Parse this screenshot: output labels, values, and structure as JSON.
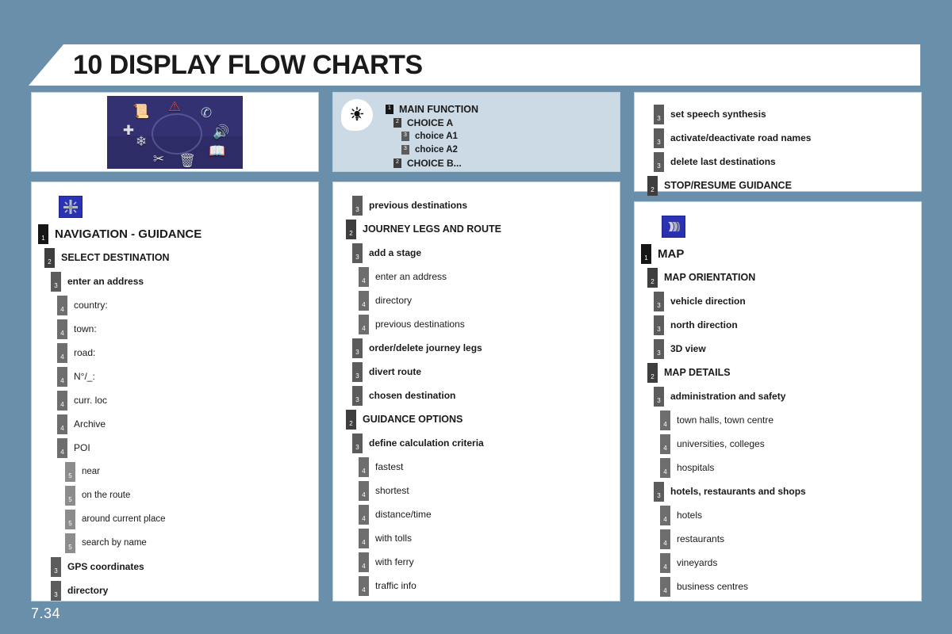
{
  "page": {
    "background_color": "#6a8fab",
    "title": "10 DISPLAY FLOW CHARTS",
    "page_number": "7.34"
  },
  "screenshot_panel": {
    "icon_names": [
      "documents-icon",
      "warning-triangle-icon",
      "telephone-icon",
      "radio-icon",
      "books-icon",
      "trash-icon",
      "tools-icon",
      "air-conditioning-icon",
      "navigation-icon"
    ]
  },
  "legend": {
    "bulb_icon": "lightbulb-icon",
    "rows": [
      {
        "level": 1,
        "indent": 0,
        "label": "MAIN FUNCTION"
      },
      {
        "level": 2,
        "indent": 1,
        "label": "CHOICE A"
      },
      {
        "level": 3,
        "indent": 2,
        "label": "choice A1"
      },
      {
        "level": 3,
        "indent": 2,
        "label": "choice A2"
      },
      {
        "level": 2,
        "indent": 1,
        "label": "CHOICE B..."
      }
    ]
  },
  "columns": [
    {
      "name": "navigation-guidance-column",
      "section_icon": "crossroads-icon",
      "rows": [
        {
          "level": 1,
          "indent": 0,
          "label": "NAVIGATION - GUIDANCE"
        },
        {
          "level": 2,
          "indent": 1,
          "label": "SELECT DESTINATION"
        },
        {
          "level": 3,
          "indent": 2,
          "label": "enter an address"
        },
        {
          "level": 4,
          "indent": 3,
          "label": "country:"
        },
        {
          "level": 4,
          "indent": 3,
          "label": "town:"
        },
        {
          "level": 4,
          "indent": 3,
          "label": "road:"
        },
        {
          "level": 4,
          "indent": 3,
          "label": "N°/_:"
        },
        {
          "level": 4,
          "indent": 3,
          "label": "curr. loc"
        },
        {
          "level": 4,
          "indent": 3,
          "label": "Archive"
        },
        {
          "level": 4,
          "indent": 3,
          "label": "POI"
        },
        {
          "level": 5,
          "indent": 4,
          "label": "near"
        },
        {
          "level": 5,
          "indent": 4,
          "label": "on the route"
        },
        {
          "level": 5,
          "indent": 4,
          "label": "around current place"
        },
        {
          "level": 5,
          "indent": 4,
          "label": "search by name"
        },
        {
          "level": 3,
          "indent": 2,
          "label": "GPS coordinates"
        },
        {
          "level": 3,
          "indent": 2,
          "label": "directory"
        }
      ]
    },
    {
      "name": "journey-column",
      "rows": [
        {
          "level": 3,
          "indent": 2,
          "label": "previous destinations"
        },
        {
          "level": 2,
          "indent": 1,
          "label": "JOURNEY LEGS AND ROUTE"
        },
        {
          "level": 3,
          "indent": 2,
          "label": "add a stage"
        },
        {
          "level": 4,
          "indent": 3,
          "label": "enter an address"
        },
        {
          "level": 4,
          "indent": 3,
          "label": "directory"
        },
        {
          "level": 4,
          "indent": 3,
          "label": "previous destinations"
        },
        {
          "level": 3,
          "indent": 2,
          "label": "order/delete journey legs"
        },
        {
          "level": 3,
          "indent": 2,
          "label": "divert route"
        },
        {
          "level": 3,
          "indent": 2,
          "label": "chosen destination"
        },
        {
          "level": 2,
          "indent": 1,
          "label": "GUIDANCE OPTIONS"
        },
        {
          "level": 3,
          "indent": 2,
          "label": "define calculation criteria"
        },
        {
          "level": 4,
          "indent": 3,
          "label": "fastest"
        },
        {
          "level": 4,
          "indent": 3,
          "label": "shortest"
        },
        {
          "level": 4,
          "indent": 3,
          "label": "distance/time"
        },
        {
          "level": 4,
          "indent": 3,
          "label": "with tolls"
        },
        {
          "level": 4,
          "indent": 3,
          "label": "with ferry"
        },
        {
          "level": 4,
          "indent": 3,
          "label": "traffic info"
        }
      ]
    }
  ],
  "right_top_panel": {
    "name": "speech-guidance-panel",
    "rows": [
      {
        "level": 3,
        "indent": 2,
        "label": "set speech synthesis"
      },
      {
        "level": 3,
        "indent": 2,
        "label": "activate/deactivate road names"
      },
      {
        "level": 3,
        "indent": 2,
        "label": "delete last destinations"
      },
      {
        "level": 2,
        "indent": 1,
        "label": "STOP/RESUME GUIDANCE"
      }
    ]
  },
  "right_bottom_panel": {
    "name": "map-column",
    "section_icon": "folded-map-icon",
    "rows": [
      {
        "level": 1,
        "indent": 0,
        "label": "MAP"
      },
      {
        "level": 2,
        "indent": 1,
        "label": "MAP ORIENTATION"
      },
      {
        "level": 3,
        "indent": 2,
        "label": "vehicle direction"
      },
      {
        "level": 3,
        "indent": 2,
        "label": "north direction"
      },
      {
        "level": 3,
        "indent": 2,
        "label": "3D view"
      },
      {
        "level": 2,
        "indent": 1,
        "label": "MAP DETAILS"
      },
      {
        "level": 3,
        "indent": 2,
        "label": "administration and safety"
      },
      {
        "level": 4,
        "indent": 3,
        "label": "town halls, town centre"
      },
      {
        "level": 4,
        "indent": 3,
        "label": "universities, colleges"
      },
      {
        "level": 4,
        "indent": 3,
        "label": "hospitals"
      },
      {
        "level": 3,
        "indent": 2,
        "label": "hotels, restaurants and shops"
      },
      {
        "level": 4,
        "indent": 3,
        "label": "hotels"
      },
      {
        "level": 4,
        "indent": 3,
        "label": "restaurants"
      },
      {
        "level": 4,
        "indent": 3,
        "label": "vineyards"
      },
      {
        "level": 4,
        "indent": 3,
        "label": "business centres"
      }
    ]
  }
}
